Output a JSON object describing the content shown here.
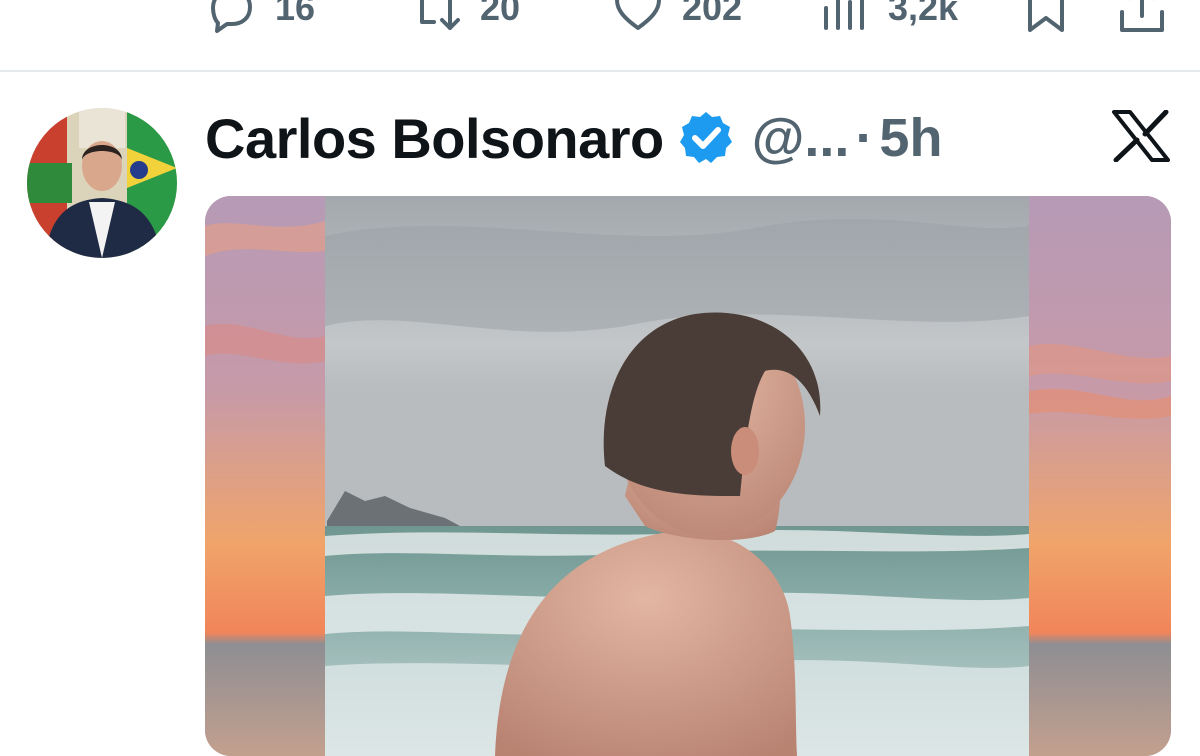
{
  "previous_tweet_actions": {
    "replies": "16",
    "reposts": "20",
    "likes": "202",
    "views": "3,2k"
  },
  "tweet": {
    "author_name": "Carlos Bolsonaro",
    "handle": "@...",
    "separator": "·",
    "time": "5h"
  },
  "icons": {
    "reply": "reply-icon",
    "repost": "repost-icon",
    "like": "heart-icon",
    "views": "views-icon",
    "bookmark": "bookmark-icon",
    "share": "share-icon",
    "verified": "verified-badge-icon",
    "platform": "x-logo-icon"
  },
  "colors": {
    "verified_blue": "#1d9bf0",
    "muted_text": "#536471",
    "primary_text": "#0f1419"
  }
}
